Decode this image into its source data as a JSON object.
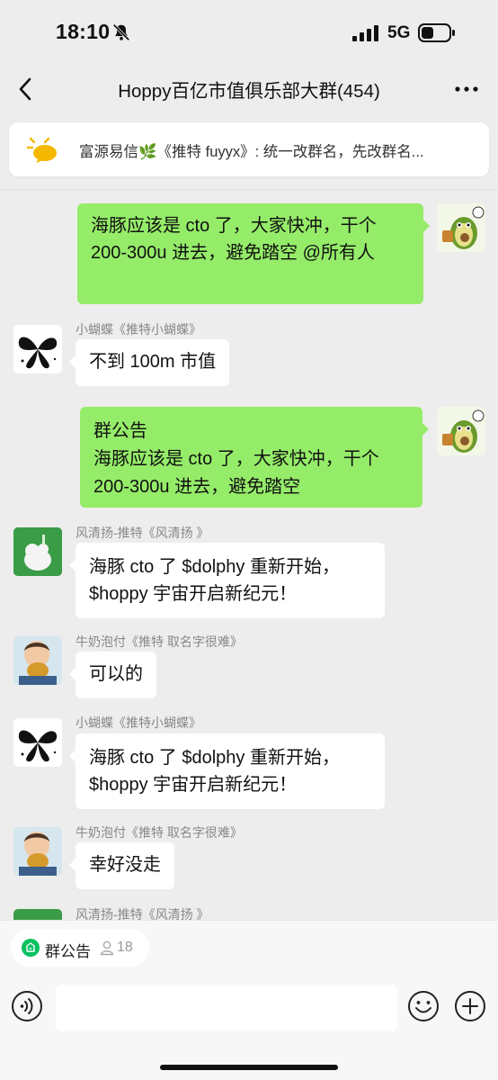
{
  "status_bar": {
    "time": "18:10",
    "network": "5G"
  },
  "header": {
    "title": "Hoppy百亿市值俱乐部大群(454)"
  },
  "pinned": {
    "text": "富源易信🌿《推特 fuyyx》: 统一改群名，先改群名..."
  },
  "messages": [
    {
      "side": "right",
      "lines": [
        "海豚应该是 cto 了，大家快冲，干个",
        "200-300u 进去，避免踏空 @所有人"
      ]
    },
    {
      "side": "left",
      "name": "小蝴蝶《推特小蝴蝶》",
      "lines": [
        "不到 100m 市值"
      ]
    },
    {
      "side": "right",
      "lines": [
        "群公告",
        "海豚应该是 cto 了，大家快冲，干个",
        "200-300u 进去，避免踏空"
      ]
    },
    {
      "side": "left",
      "name": "风清扬-推特《风清扬 》",
      "lines": [
        "海豚 cto 了 $dolphy 重新开始，",
        "$hoppy  宇宙开启新纪元！"
      ]
    },
    {
      "side": "left",
      "name": "牛奶泡付《推特 取名字很难》",
      "lines": [
        "可以的"
      ]
    },
    {
      "side": "left",
      "name": "小蝴蝶《推特小蝴蝶》",
      "lines": [
        "海豚 cto 了 $dolphy 重新开始，",
        "$hoppy  宇宙开启新纪元！"
      ]
    },
    {
      "side": "left",
      "name": "牛奶泡付《推特 取名字很难》",
      "lines": [
        "幸好没走"
      ]
    },
    {
      "side": "left",
      "name": "风清扬-推特《风清扬 》",
      "lines": []
    }
  ],
  "announcement_chip": {
    "label": "群公告",
    "count": "18"
  },
  "icons": [
    "back-icon",
    "more-icon",
    "bulb-icon",
    "voice-icon",
    "emoji-icon",
    "plus-icon",
    "bell-muted-icon"
  ],
  "colors": {
    "green_bubble": "#95ec69",
    "background": "#ededed",
    "chip_icon": "#07c160"
  }
}
